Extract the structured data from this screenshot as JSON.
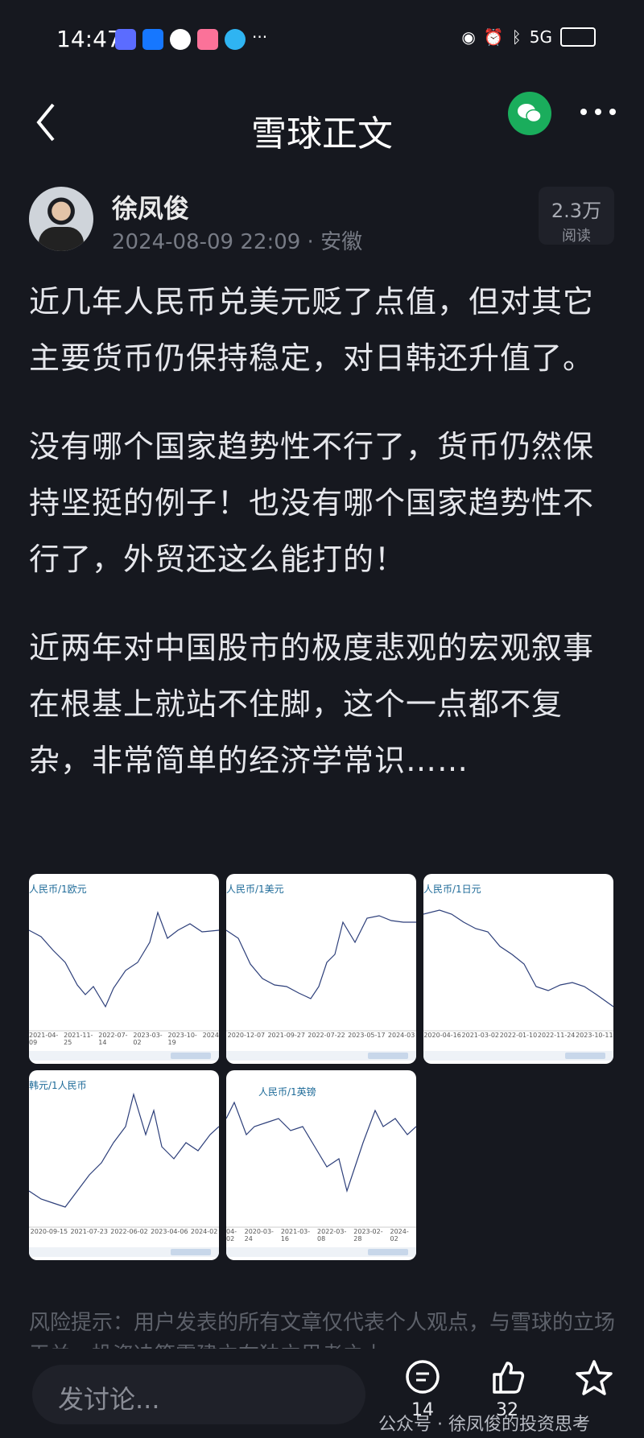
{
  "status_bar": {
    "time": "14:47",
    "signal": "5G"
  },
  "nav": {
    "title": "雪球正文"
  },
  "author": {
    "name": "徐凤俊",
    "meta": "2024-08-09 22:09 · 安徽",
    "reads_count": "2.3万",
    "reads_label": "阅读"
  },
  "paragraphs": [
    "近几年人民币兑美元贬了点值，但对其它主要货币仍保持稳定，对日韩还升值了。",
    "没有哪个国家趋势性不行了，货币仍然保持坚挺的例子！也没有哪个国家趋势性不行了，外贸还这么能打的！",
    "近两年对中国股市的极度悲观的宏观叙事在根基上就站不住脚，这个一点都不复杂，非常简单的经济学常识……"
  ],
  "thumbnails": [
    {
      "label": "人民币/1欧元",
      "dates": [
        "2021-04-09",
        "2021-11-25",
        "2022-07-14",
        "2023-03-02",
        "2023-10-19",
        "2024"
      ]
    },
    {
      "label": "人民币/1美元",
      "dates": [
        "2020-12-07",
        "2021-09-27",
        "2022-07-22",
        "2023-05-17",
        "2024-03"
      ]
    },
    {
      "label": "人民币/1日元",
      "dates": [
        "2020-04-16",
        "2021-03-02",
        "2022-01-10",
        "2022-11-24",
        "2023-10-11"
      ]
    },
    {
      "label": "韩元/1人民币",
      "dates": [
        "2020-09-15",
        "2021-07-23",
        "2022-06-02",
        "2023-04-06",
        "2024-02"
      ]
    },
    {
      "label": "人民币/1英镑",
      "dates": [
        "04-02",
        "2020-03-24",
        "2021-03-16",
        "2022-03-08",
        "2023-02-28",
        "2024-02"
      ]
    }
  ],
  "risk_notice": "风险提示：用户发表的所有文章仅代表个人观点，与雪球的立场无关。投资决策需建立在独立思考之上",
  "bottom_bar": {
    "input_placeholder": "发讨论...",
    "comments": "14",
    "likes": "32",
    "favorites": ""
  },
  "watermark": "公众号 · 徐凤俊的投资思考"
}
